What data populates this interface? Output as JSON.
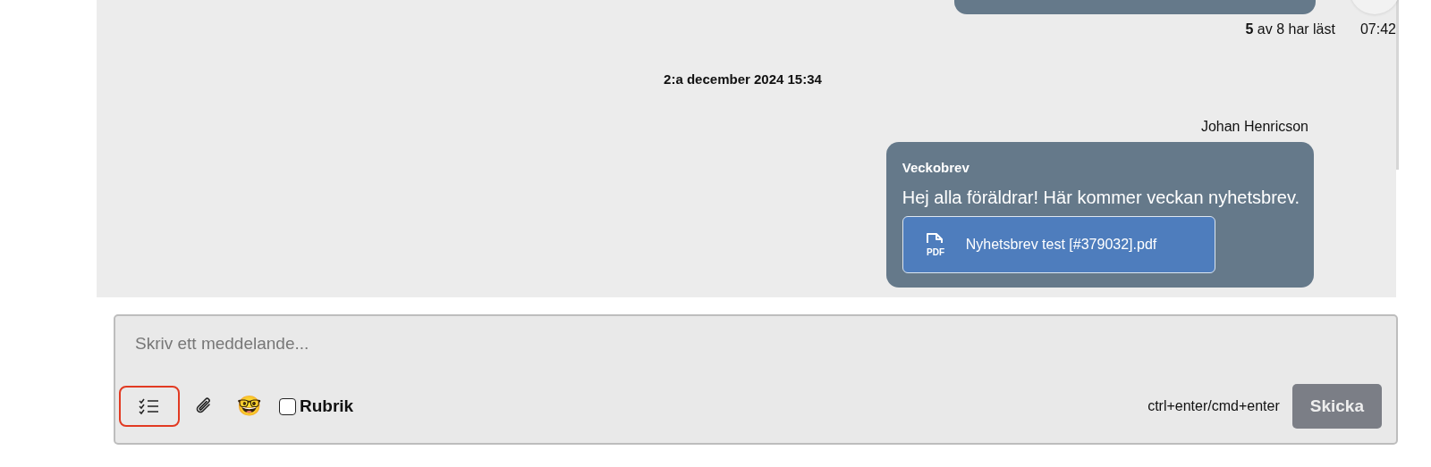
{
  "previous_message": {
    "read_count": "5",
    "read_text": "av 8 har läst",
    "time": "07:42"
  },
  "date_divider": "2:a december 2024 15:34",
  "message": {
    "sender": "Johan Henricson",
    "title": "Veckobrev",
    "body": "Hej alla föräldrar! Här kommer veckan nyhetsbrev.",
    "attachment": {
      "kind": "pdf",
      "label": "PDF",
      "name": "Nyhetsbrev test [#379032].pdf"
    }
  },
  "composer": {
    "placeholder": "Skriv ett meddelande...",
    "tools": [
      {
        "kind": "checklist",
        "selected": true
      },
      {
        "kind": "attach",
        "selected": false
      },
      {
        "kind": "emoji",
        "glyph": "🤓",
        "selected": false
      }
    ],
    "heading_option": {
      "label": "Rubrik",
      "checked": false
    },
    "shortcut_hint": "ctrl+enter/cmd+enter",
    "send_button": "Skicka"
  }
}
